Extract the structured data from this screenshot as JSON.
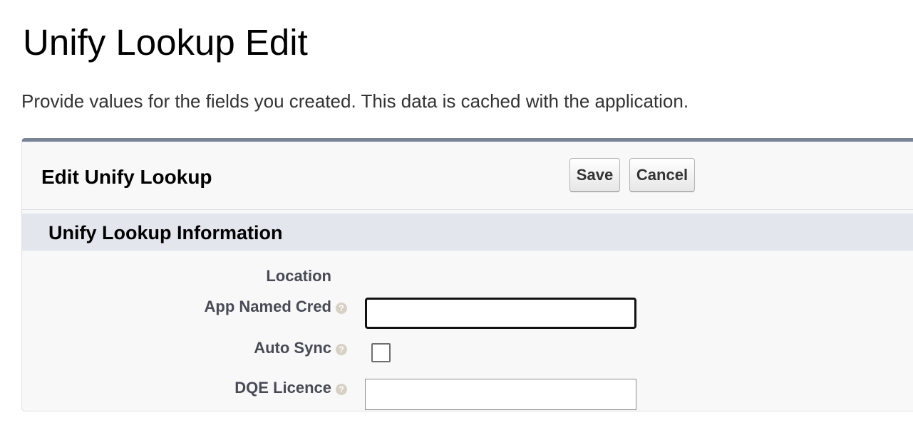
{
  "page": {
    "title": "Unify Lookup Edit",
    "description": "Provide values for the fields you created. This data is cached with the application."
  },
  "panel": {
    "title": "Edit Unify Lookup",
    "save_label": "Save",
    "cancel_label": "Cancel"
  },
  "section": {
    "title": "Unify Lookup Information"
  },
  "fields": {
    "location": {
      "label": "Location"
    },
    "app_named_cred": {
      "label": "App Named Cred",
      "value": "",
      "help_icon": "question-mark"
    },
    "auto_sync": {
      "label": "Auto Sync",
      "checked": false,
      "help_icon": "question-mark"
    },
    "dqe_licence": {
      "label": "DQE Licence",
      "value": "",
      "help_icon": "question-mark"
    }
  },
  "colors": {
    "panel_border_top": "#7a8295",
    "section_header_bg": "#e3e6ed",
    "help_icon": "#d6d1c4"
  }
}
